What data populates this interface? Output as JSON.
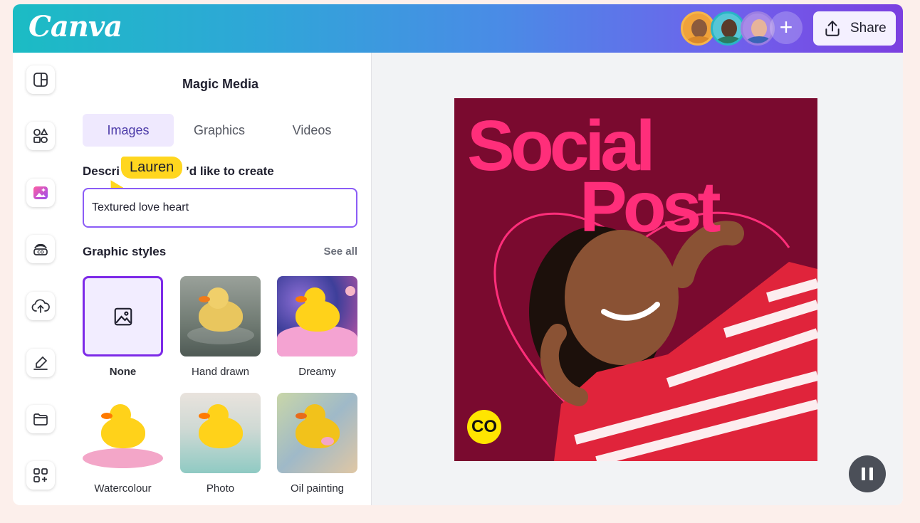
{
  "brand": {
    "logo_text": "Canva"
  },
  "header": {
    "share_label": "Share",
    "collaborators": [
      {
        "name": "collaborator-1",
        "skin": "#8b5a3c",
        "shirt": "#d9882a",
        "bg": "#f0a23a"
      },
      {
        "name": "collaborator-2",
        "skin": "#5a3b2a",
        "shirt": "#2a7c62",
        "bg": "#56c6d6"
      },
      {
        "name": "collaborator-3",
        "skin": "#e7b49a",
        "shirt": "#3a64b7",
        "bg": "#a88ae8"
      }
    ],
    "add_collaborator_symbol": "+"
  },
  "rail": {
    "items": [
      {
        "icon": "layout-icon"
      },
      {
        "icon": "elements-icon"
      },
      {
        "icon": "magic-media-icon"
      },
      {
        "icon": "brand-icon"
      },
      {
        "icon": "upload-icon"
      },
      {
        "icon": "draw-icon"
      },
      {
        "icon": "folder-icon"
      },
      {
        "icon": "apps-icon"
      }
    ]
  },
  "panel": {
    "title": "Magic Media",
    "tabs": [
      "Images",
      "Graphics",
      "Videos"
    ],
    "active_tab": "Images",
    "describe_label": "Describe what you’d like to create",
    "describe_label_visible_start": "Descri",
    "describe_label_visible_end": "’d like to create",
    "cursor_name": "Lauren",
    "prompt_value": "Textured love heart",
    "styles_title": "Graphic styles",
    "see_all": "See all",
    "styles": [
      {
        "label": "None",
        "selected": true
      },
      {
        "label": "Hand drawn"
      },
      {
        "label": "Dreamy"
      },
      {
        "label": "Watercolour"
      },
      {
        "label": "Photo"
      },
      {
        "label": "Oil painting"
      }
    ]
  },
  "design": {
    "headline_line1": "Social",
    "headline_line2": "Post",
    "brand_mark": "CO",
    "background_color": "#7a0a2f",
    "headline_color": "#ff2e7a"
  },
  "player": {
    "state": "playing",
    "control_icon": "pause-icon"
  }
}
